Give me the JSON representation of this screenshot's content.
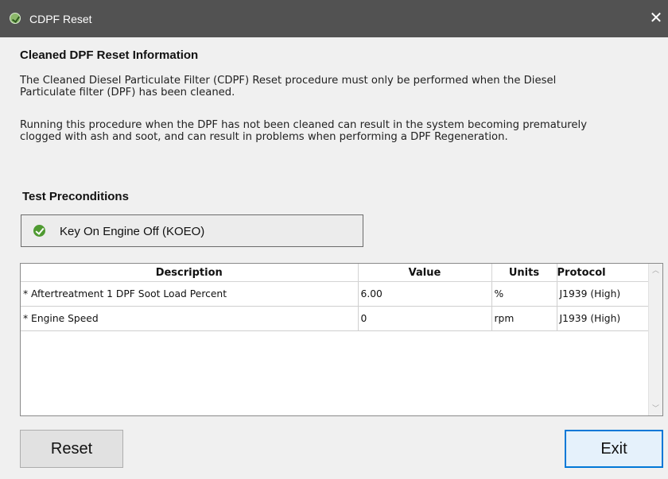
{
  "window": {
    "title": "CDPF Reset",
    "close_glyph": "✕"
  },
  "info": {
    "heading": "Cleaned DPF Reset Information",
    "paragraph1_line1": "The Cleaned Diesel Particulate Filter (CDPF) Reset procedure must only be performed when the Diesel",
    "paragraph1_line2": "Particulate filter (DPF) has been cleaned.",
    "paragraph2_line1": "Running this procedure when the DPF has not been cleaned can result in the system becoming prematurely",
    "paragraph2_line2": "clogged with ash and soot, and can result in problems when performing a DPF Regeneration."
  },
  "preconditions": {
    "heading": "Test Preconditions",
    "items": [
      {
        "label": "Key On Engine Off (KOEO)",
        "icon": "check-circle-icon",
        "status_color": "#4f9a31"
      }
    ]
  },
  "table": {
    "headers": {
      "description": "Description",
      "value": "Value",
      "units": "Units",
      "protocol": "Protocol"
    },
    "rows": [
      {
        "description": "* Aftertreatment 1 DPF Soot Load Percent",
        "value": "6.00",
        "units": "%",
        "protocol": "J1939 (High)"
      },
      {
        "description": "* Engine Speed",
        "value": "0",
        "units": "rpm",
        "protocol": "J1939 (High)"
      }
    ]
  },
  "buttons": {
    "reset": "Reset",
    "exit": "Exit"
  },
  "scrollbar": {
    "up_glyph": "︿",
    "down_glyph": "﹀"
  },
  "colors": {
    "titlebar": "#525252",
    "focus_border": "#0078d7"
  }
}
